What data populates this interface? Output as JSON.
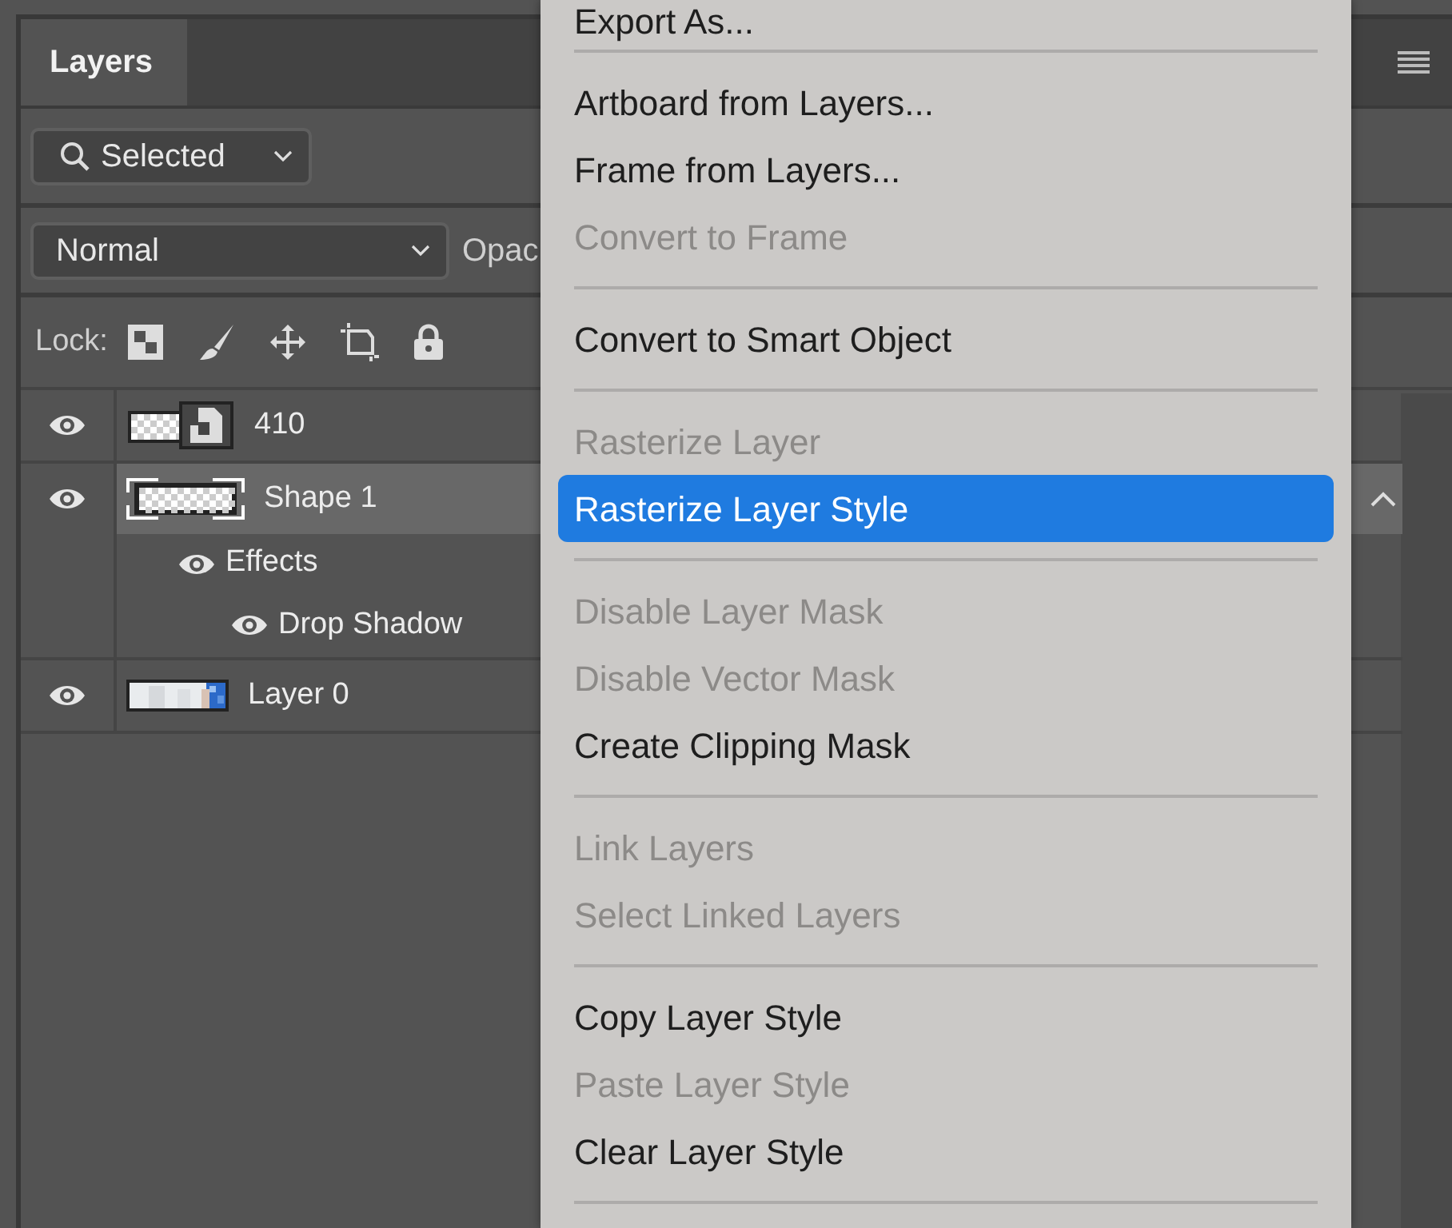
{
  "panel": {
    "tab": {
      "label": "Layers",
      "selected": true
    },
    "filter": {
      "value": "Selected"
    },
    "blend_mode": {
      "value": "Normal"
    },
    "opacity_label": "Opac",
    "lock_label": "Lock:"
  },
  "layers": [
    {
      "name": "410",
      "kind": "smart",
      "visible": true,
      "selected": false
    },
    {
      "name": "Shape 1",
      "kind": "shape",
      "visible": true,
      "selected": true,
      "expanded": true,
      "children": [
        {
          "name": "Effects",
          "visible": true,
          "children": [
            {
              "name": "Drop Shadow",
              "visible": true
            }
          ]
        }
      ]
    },
    {
      "name": "Layer 0",
      "kind": "image",
      "visible": true,
      "selected": false
    }
  ],
  "context_menu": {
    "items": [
      {
        "kind": "item",
        "label": "Export As...",
        "disabled": false,
        "selected": false
      },
      {
        "kind": "separator"
      },
      {
        "kind": "item",
        "label": "Artboard from Layers...",
        "disabled": false,
        "selected": false
      },
      {
        "kind": "item",
        "label": "Frame from Layers...",
        "disabled": false,
        "selected": false
      },
      {
        "kind": "item",
        "label": "Convert to Frame",
        "disabled": true,
        "selected": false
      },
      {
        "kind": "separator"
      },
      {
        "kind": "item",
        "label": "Convert to Smart Object",
        "disabled": false,
        "selected": false
      },
      {
        "kind": "separator"
      },
      {
        "kind": "item",
        "label": "Rasterize Layer",
        "disabled": true,
        "selected": false
      },
      {
        "kind": "item",
        "label": "Rasterize Layer Style",
        "disabled": false,
        "selected": true
      },
      {
        "kind": "separator"
      },
      {
        "kind": "item",
        "label": "Disable Layer Mask",
        "disabled": true,
        "selected": false
      },
      {
        "kind": "item",
        "label": "Disable Vector Mask",
        "disabled": true,
        "selected": false
      },
      {
        "kind": "item",
        "label": "Create Clipping Mask",
        "disabled": false,
        "selected": false
      },
      {
        "kind": "separator"
      },
      {
        "kind": "item",
        "label": "Link Layers",
        "disabled": true,
        "selected": false
      },
      {
        "kind": "item",
        "label": "Select Linked Layers",
        "disabled": true,
        "selected": false
      },
      {
        "kind": "separator"
      },
      {
        "kind": "item",
        "label": "Copy Layer Style",
        "disabled": false,
        "selected": false
      },
      {
        "kind": "item",
        "label": "Paste Layer Style",
        "disabled": true,
        "selected": false
      },
      {
        "kind": "item",
        "label": "Clear Layer Style",
        "disabled": false,
        "selected": false
      },
      {
        "kind": "separator"
      }
    ]
  }
}
